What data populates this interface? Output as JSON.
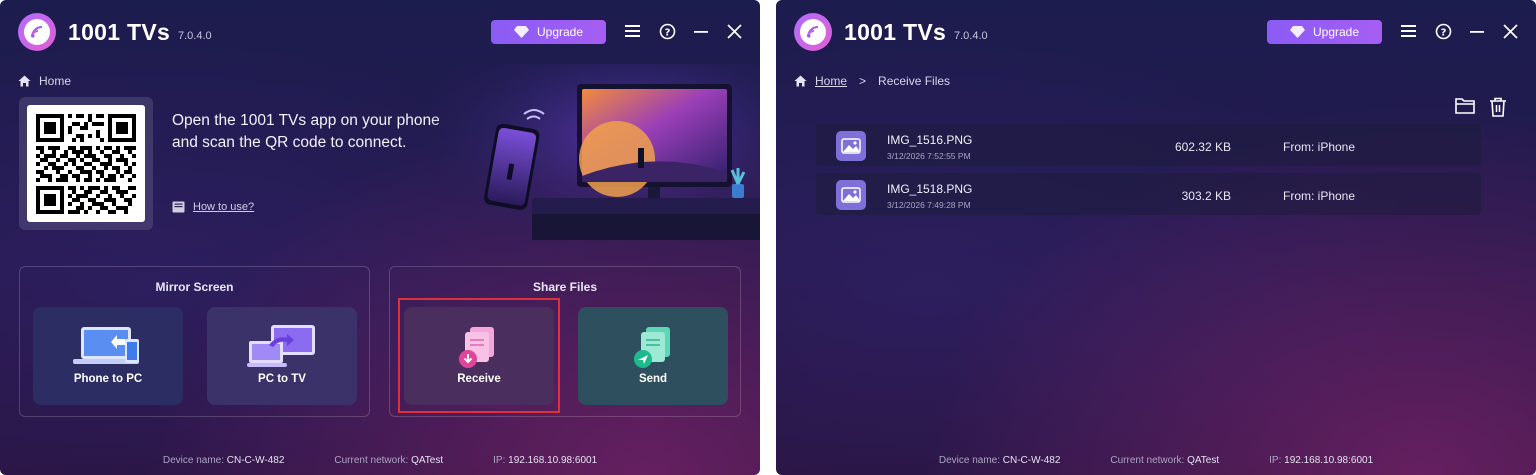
{
  "app": {
    "name": "1001 TVs",
    "version": "7.0.4.0",
    "upgrade_label": "Upgrade"
  },
  "left": {
    "breadcrumb": {
      "home": "Home"
    },
    "connect_line1": "Open the 1001 TVs app on your phone",
    "connect_line2": "and scan the QR code to connect.",
    "how_to": "How to use?",
    "mirror": {
      "title": "Mirror Screen",
      "phone_to_pc": "Phone to PC",
      "pc_to_tv": "PC to TV"
    },
    "share": {
      "title": "Share Files",
      "receive": "Receive",
      "send": "Send"
    }
  },
  "right": {
    "breadcrumb": {
      "home": "Home",
      "separator": ">",
      "current": "Receive Files"
    },
    "files": [
      {
        "name": "IMG_1516.PNG",
        "date": "3/12/2026 7:52:55 PM",
        "size": "602.32 KB",
        "from": "From:  iPhone"
      },
      {
        "name": "IMG_1518.PNG",
        "date": "3/12/2026 7:49:28 PM",
        "size": "303.2 KB",
        "from": "From:  iPhone"
      }
    ]
  },
  "status": {
    "device_label": "Device name:",
    "device_value": "CN-C-W-482",
    "network_label": "Current network:",
    "network_value": "QATest",
    "ip_label": "IP:",
    "ip_value": "192.168.10.98:6001"
  },
  "colors": {
    "accent": "#8a5cf5",
    "highlight": "#e0303a"
  }
}
